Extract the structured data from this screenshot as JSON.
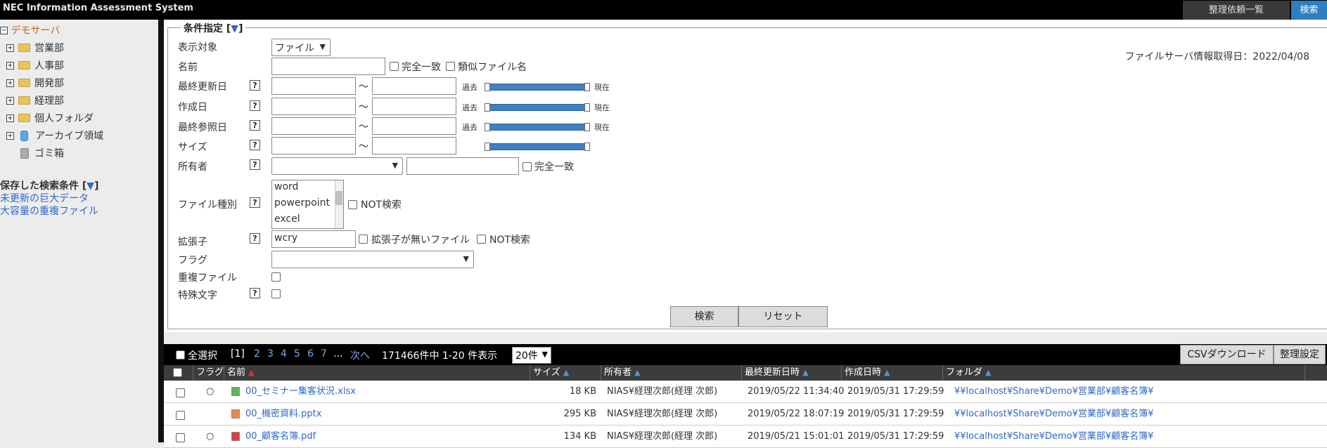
{
  "app": {
    "title": "NEC Information Assessment System"
  },
  "top_buttons": {
    "reorg_list": "整理依頼一覧",
    "search": "検索"
  },
  "tree": {
    "root": "デモサーバ",
    "items": [
      {
        "label": "営業部",
        "icon": "folder-icon"
      },
      {
        "label": "人事部",
        "icon": "folder-icon"
      },
      {
        "label": "開発部",
        "icon": "folder-icon"
      },
      {
        "label": "経理部",
        "icon": "folder-icon"
      },
      {
        "label": "個人フォルダ",
        "icon": "folder-icon"
      },
      {
        "label": "アーカイブ領域",
        "icon": "archive-icon"
      }
    ],
    "trash": "ゴミ箱"
  },
  "saved": {
    "title": "保存した検索条件 [",
    "close": "]",
    "items": [
      "未更新の巨大データ",
      "大容量の重複ファイル"
    ]
  },
  "conditions": {
    "legend": "条件指定 [",
    "legend_close": "]",
    "server_date": "ファイルサーバ情報取得日：2022/04/08",
    "display_target": {
      "label": "表示対象",
      "value": "ファイル"
    },
    "name": {
      "label": "名前",
      "exact": "完全一致",
      "similar": "類似ファイル名"
    },
    "last_modified": {
      "label": "最終更新日",
      "tilde": "～",
      "past": "過去",
      "now": "現在"
    },
    "created": {
      "label": "作成日",
      "tilde": "～",
      "past": "過去",
      "now": "現在"
    },
    "last_accessed": {
      "label": "最終参照日",
      "tilde": "～",
      "past": "過去",
      "now": "現在"
    },
    "size": {
      "label": "サイズ",
      "tilde": "～"
    },
    "owner": {
      "label": "所有者",
      "exact": "完全一致"
    },
    "file_type": {
      "label": "ファイル種別",
      "options": [
        "word",
        "powerpoint",
        "excel"
      ],
      "not_search": "NOT検索"
    },
    "extension": {
      "label": "拡張子",
      "value": "wcry",
      "no_ext": "拡張子が無いファイル",
      "not_search": "NOT検索"
    },
    "flag": {
      "label": "フラグ"
    },
    "duplicate": {
      "label": "重複ファイル"
    },
    "special_chars": {
      "label": "特殊文字"
    },
    "help": "?",
    "search_btn": "検索",
    "reset_btn": "リセット"
  },
  "results": {
    "select_all": "全選択",
    "pages": [
      "[1]",
      "2",
      "3",
      "4",
      "5",
      "6",
      "7"
    ],
    "ellipsis": "...",
    "next": "次へ",
    "summary": "171466件中 1-20 件表示",
    "per_page": "20件",
    "csv": "CSVダウンロード",
    "settings": "整理設定",
    "columns": [
      "フラグ",
      "名前",
      "サイズ",
      "所有者",
      "最終更新日時",
      "作成日時",
      "フォルダ"
    ],
    "rows": [
      {
        "flag": "○",
        "name": "00_セミナー集客状況.xlsx",
        "icon": "excel-file-icon",
        "size": "18 KB",
        "owner": "NIAS¥経理次郎(経理 次郎)",
        "modified": "2019/05/22 11:34:40",
        "created": "2019/05/31 17:29:59",
        "folder": "¥¥localhost¥Share¥Demo¥営業部¥顧客名簿¥"
      },
      {
        "flag": "",
        "name": "00_機密資料.pptx",
        "icon": "powerpoint-file-icon",
        "size": "295 KB",
        "owner": "NIAS¥経理次郎(経理 次郎)",
        "modified": "2019/05/22 18:07:19",
        "created": "2019/05/31 17:29:59",
        "folder": "¥¥localhost¥Share¥Demo¥営業部¥顧客名簿¥"
      },
      {
        "flag": "○",
        "name": "00_顧客名簿.pdf",
        "icon": "pdf-file-icon",
        "size": "134 KB",
        "owner": "NIAS¥経理次郎(経理 次郎)",
        "modified": "2019/05/21 15:01:01",
        "created": "2019/05/31 17:29:59",
        "folder": "¥¥localhost¥Share¥Demo¥営業部¥顧客名簿¥"
      }
    ]
  },
  "colors": {
    "accent": "#2d7fc0",
    "root": "#e05a00",
    "link": "#2f67c9",
    "slider": "#3f7fc3"
  }
}
